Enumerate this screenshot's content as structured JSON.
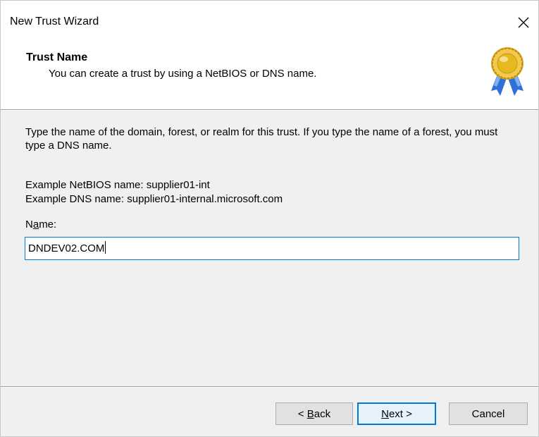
{
  "window": {
    "title": "New Trust Wizard"
  },
  "header": {
    "title": "Trust Name",
    "subtitle": "You can create a trust by using a NetBIOS or DNS name.",
    "icon": "award-medal-icon"
  },
  "content": {
    "description": "Type the name of the domain, forest, or realm for this trust. If you type the name of a forest, you must type a DNS name.",
    "example_netbios": "Example NetBIOS name: supplier01-int",
    "example_dns": "Example DNS name: supplier01-internal.microsoft.com",
    "name_label_prefix": "N",
    "name_label_underlined": "a",
    "name_label_suffix": "me:",
    "name_value": "DNDEV02.COM"
  },
  "buttons": {
    "back_prefix": "< ",
    "back_underlined": "B",
    "back_suffix": "ack",
    "next_underlined": "N",
    "next_suffix": "ext >",
    "cancel": "Cancel"
  },
  "colors": {
    "focus_accent": "#0078d7",
    "window_bg": "#f0f0f0",
    "header_bg": "#ffffff",
    "medal_gold": "#e8b820",
    "ribbon_blue": "#2f6fd8"
  }
}
